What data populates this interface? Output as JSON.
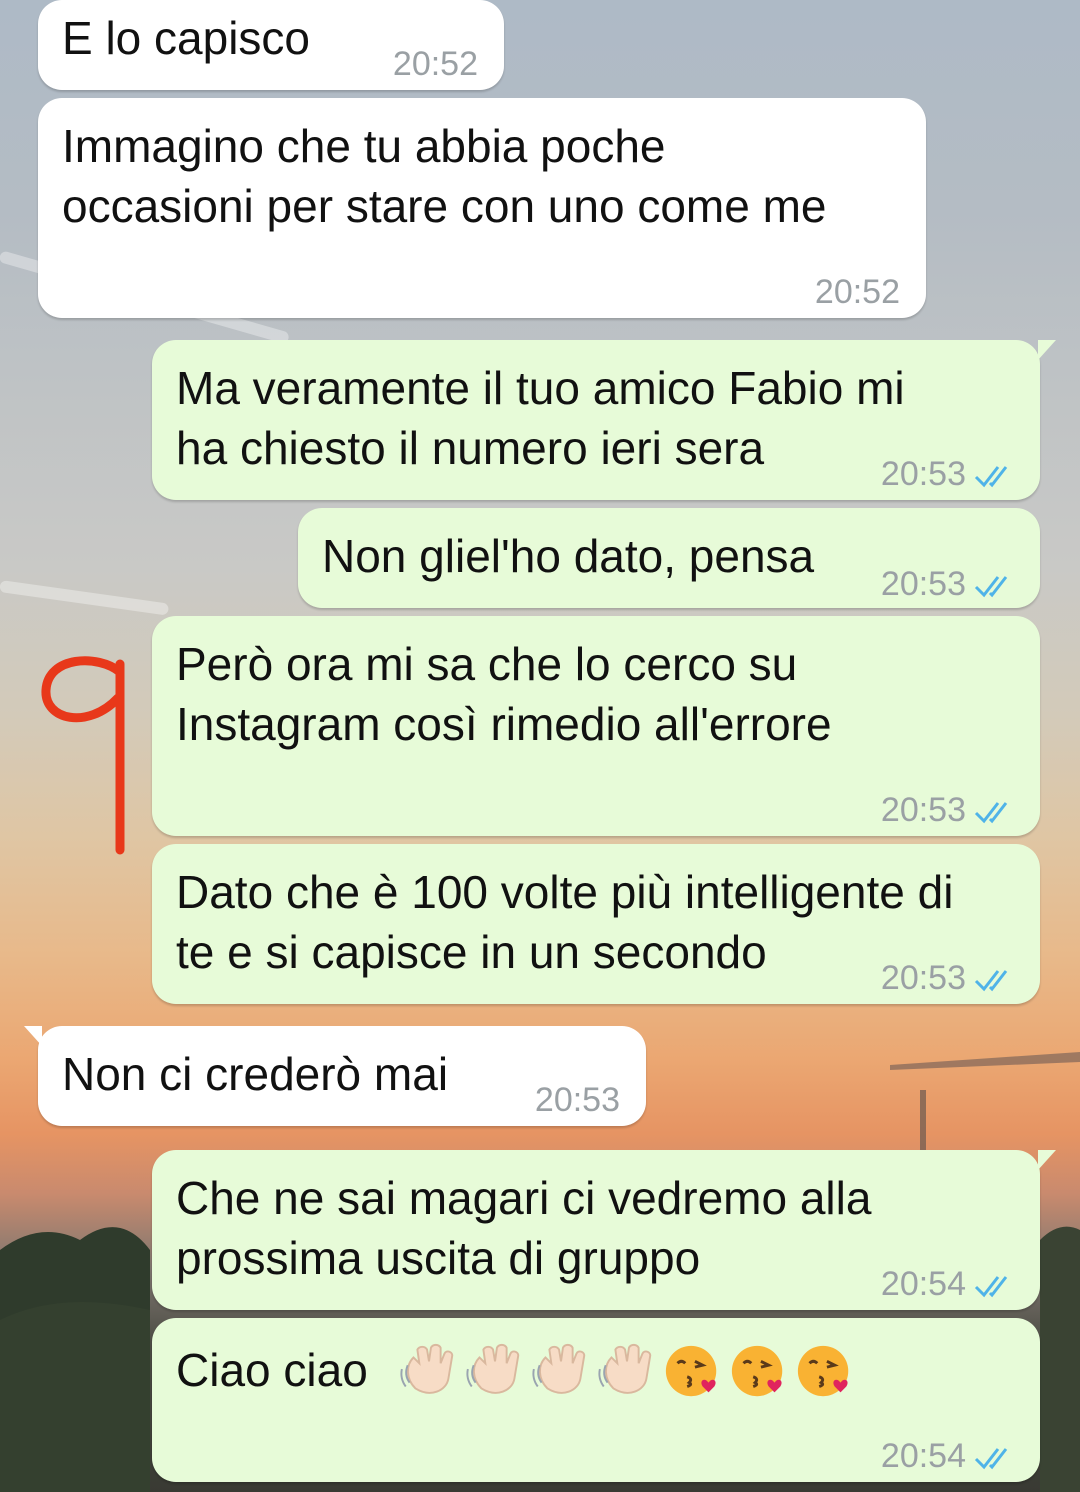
{
  "colors": {
    "incoming_bubble": "#ffffff",
    "outgoing_bubble": "#e7fbd8",
    "timestamp": "#9aa0a4",
    "read_ticks": "#4fb3e8",
    "annotation": "#e8381a"
  },
  "annotation": {
    "text": "9"
  },
  "messages": [
    {
      "direction": "incoming",
      "text": "E lo capisco",
      "time": "20:52"
    },
    {
      "direction": "incoming",
      "text": "Immagino che tu abbia poche\noccasioni per stare con uno come me",
      "time": "20:52"
    },
    {
      "direction": "outgoing",
      "text": "Ma veramente il tuo amico Fabio mi\nha chiesto il numero ieri sera",
      "time": "20:53",
      "status": "read-ticks-icon"
    },
    {
      "direction": "outgoing",
      "text": "Non gliel'ho dato, pensa",
      "time": "20:53",
      "status": "read-ticks-icon"
    },
    {
      "direction": "outgoing",
      "text": "Però ora mi sa che lo cerco su\nInstagram così rimedio all'errore",
      "time": "20:53",
      "status": "read-ticks-icon"
    },
    {
      "direction": "outgoing",
      "text": "Dato che è 100 volte più intelligente di\nte e si capisce in un secondo",
      "time": "20:53",
      "status": "read-ticks-icon"
    },
    {
      "direction": "incoming",
      "text": "Non ci crederò mai",
      "time": "20:53"
    },
    {
      "direction": "outgoing",
      "text": "Che ne sai magari ci vedremo alla\nprossima uscita di gruppo",
      "time": "20:54",
      "status": "read-ticks-icon"
    },
    {
      "direction": "outgoing",
      "text": "Ciao ciao",
      "time": "20:54",
      "status": "read-ticks-icon",
      "emojis": [
        "waving-hand-icon",
        "waving-hand-icon",
        "waving-hand-icon",
        "waving-hand-icon",
        "kissing-face-icon",
        "kissing-face-icon",
        "kissing-face-icon"
      ]
    }
  ]
}
